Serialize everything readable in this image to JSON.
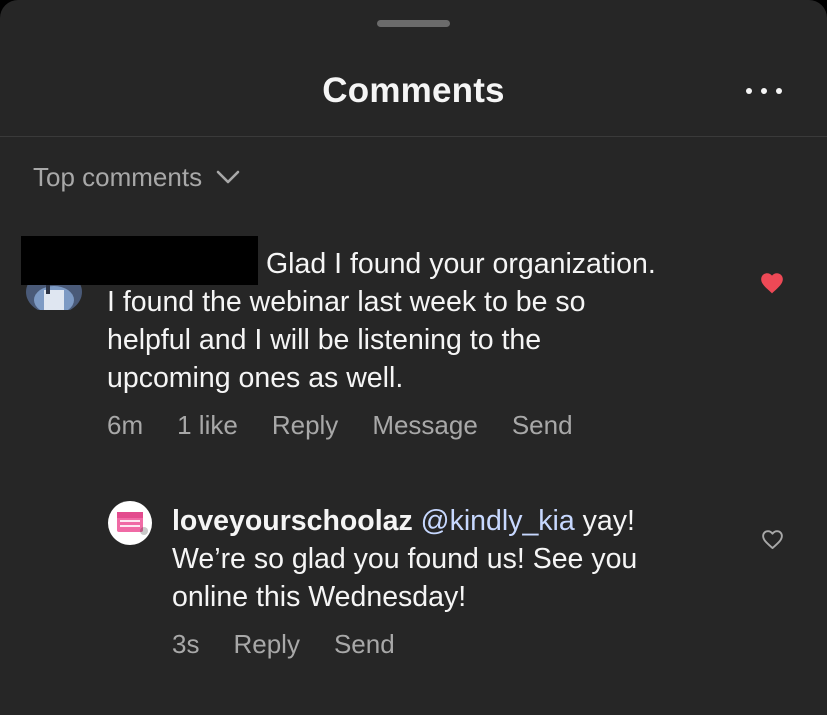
{
  "header": {
    "title": "Comments",
    "more_icon": "more-horizontal-icon"
  },
  "sort": {
    "label": "Top comments",
    "icon": "chevron-down-icon"
  },
  "comments": [
    {
      "lines": [
        "Glad I found your organization.",
        "I found the webinar last week to be so",
        "helpful and I will be listening to the",
        "upcoming ones as well."
      ],
      "time": "6m",
      "likes": "1 like",
      "actions": [
        "Reply",
        "Message",
        "Send"
      ],
      "liked": true,
      "heart_color": "#ed4956"
    },
    {
      "username": "loveyourschoolaz",
      "mention": "@kindly_kia",
      "line1_rest": " yay!",
      "lines": [
        "We’re so glad you found us! See you",
        "online this Wednesday!"
      ],
      "time": "3s",
      "actions": [
        "Reply",
        "Send"
      ],
      "liked": false
    }
  ],
  "colors": {
    "background": "#262626",
    "text": "#f5f5f5",
    "secondary": "#a8a8a8",
    "mention": "#c7d8ff",
    "like": "#ed4956"
  }
}
